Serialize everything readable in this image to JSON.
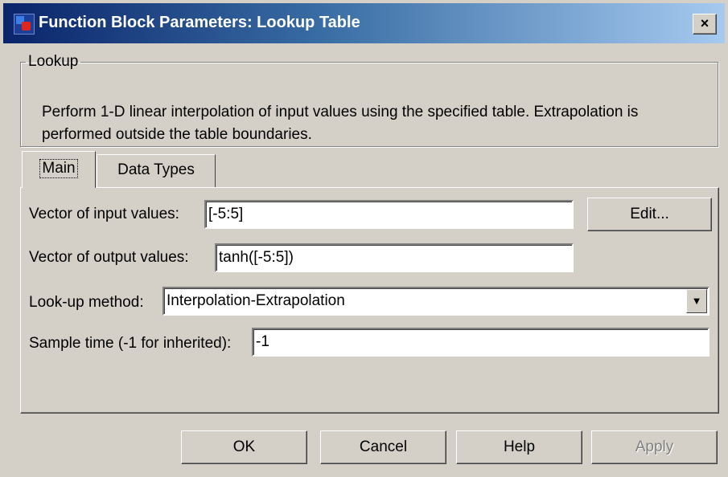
{
  "window": {
    "title": "Function Block Parameters: Lookup Table",
    "close_label": "×"
  },
  "group": {
    "legend": "Lookup",
    "description": "Perform 1-D linear interpolation of input values using the specified table.  Extrapolation is performed outside the table boundaries."
  },
  "tabs": [
    {
      "label": "Main",
      "selected": true
    },
    {
      "label": "Data Types",
      "selected": false
    }
  ],
  "params": {
    "input_values": {
      "label": "Vector of input values:",
      "value": "[-5:5]",
      "edit_label": "Edit..."
    },
    "output_values": {
      "label": "Vector of output values:",
      "value": "tanh([-5:5])"
    },
    "lookup_method": {
      "label": "Look-up method:",
      "value": "Interpolation-Extrapolation",
      "arrow": "▼"
    },
    "sample_time": {
      "label": "Sample time (-1 for inherited):",
      "value": "-1"
    }
  },
  "buttons": {
    "ok": "OK",
    "cancel": "Cancel",
    "help": "Help",
    "apply": "Apply"
  },
  "colors": {
    "titlebar_start": "#0a246a",
    "titlebar_end": "#a6caf0",
    "face": "#d4d0c8"
  }
}
